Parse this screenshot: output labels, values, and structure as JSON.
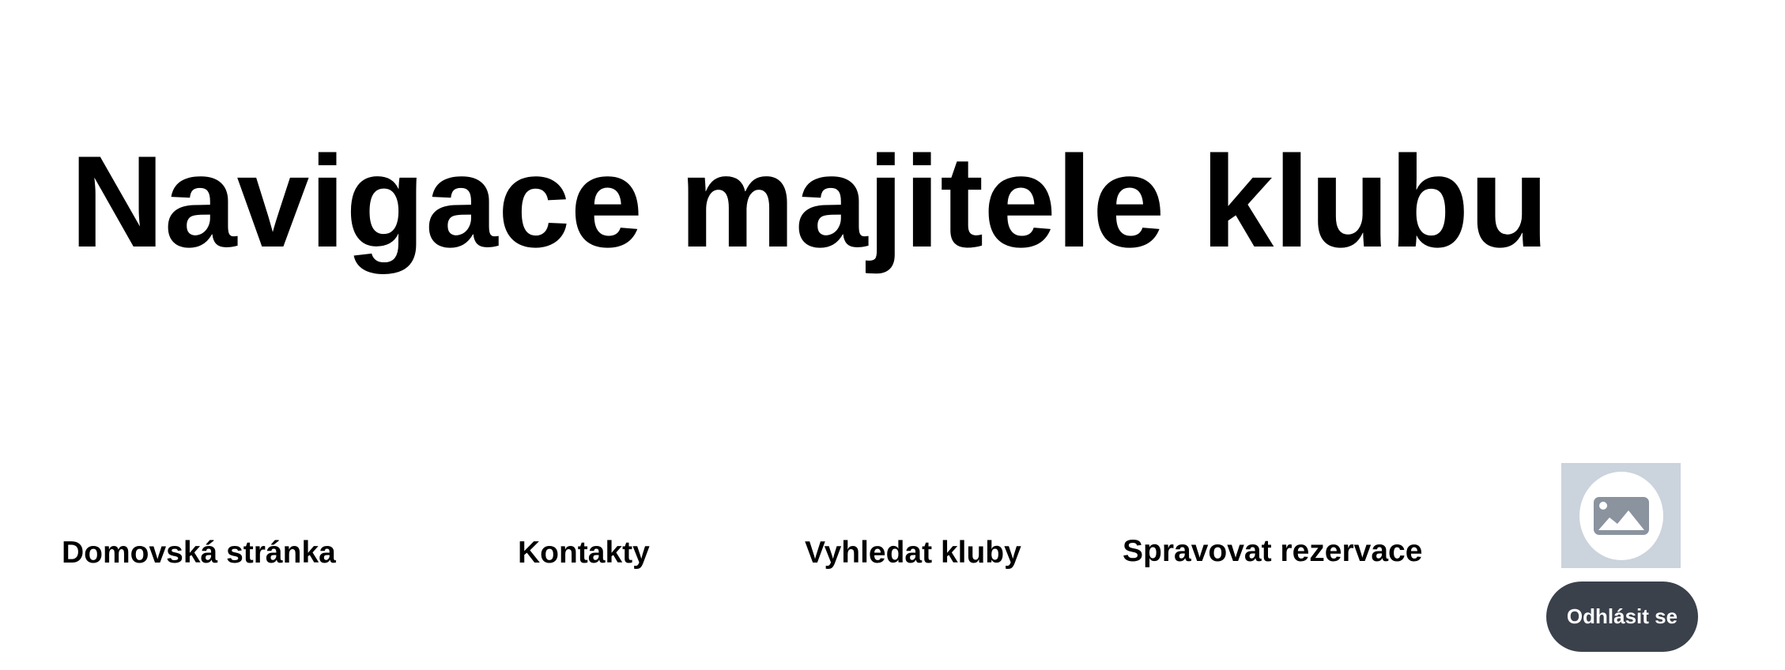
{
  "header": {
    "title": "Navigace majitele klubu"
  },
  "nav": {
    "items": [
      {
        "label": "Domovská stránka"
      },
      {
        "label": "Kontakty"
      },
      {
        "label": "Vyhledat kluby"
      },
      {
        "label": "Spravovat rezervace"
      }
    ]
  },
  "user": {
    "avatar_icon": "image-placeholder-icon",
    "logout_label": "Odhlásit se"
  },
  "colors": {
    "background": "#ffffff",
    "text": "#000000",
    "avatar_bg": "#cbd3dc",
    "avatar_icon": "#8a939e",
    "logout_bg": "#3b414b",
    "logout_text": "#ffffff"
  }
}
